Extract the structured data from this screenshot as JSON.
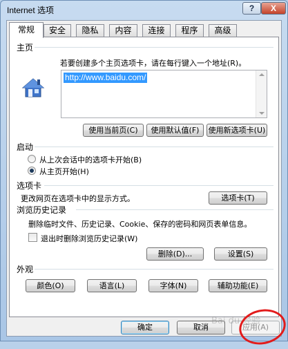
{
  "window": {
    "title": "Internet 选项",
    "help_label": "?",
    "close_label": "X"
  },
  "tabs": [
    {
      "label": "常规",
      "active": true
    },
    {
      "label": "安全"
    },
    {
      "label": "隐私"
    },
    {
      "label": "内容"
    },
    {
      "label": "连接"
    },
    {
      "label": "程序"
    },
    {
      "label": "高级"
    }
  ],
  "home": {
    "group_label": "主页",
    "instruction": "若要创建多个主页选项卡，请在每行键入一个地址(R)。",
    "url_value": "http://www.baidu.com/",
    "buttons": [
      "使用当前页(C)",
      "使用默认值(F)",
      "使用新选项卡(U)"
    ],
    "icon": "home-icon"
  },
  "startup": {
    "group_label": "启动",
    "options": [
      {
        "label": "从上次会话中的选项卡开始(B)",
        "checked": false
      },
      {
        "label": "从主页开始(H)",
        "checked": true
      }
    ]
  },
  "tabs_section": {
    "group_label": "选项卡",
    "description": "更改网页在选项卡中的显示方式。",
    "button": "选项卡(T)"
  },
  "history": {
    "group_label": "浏览历史记录",
    "description": "删除临时文件、历史记录、Cookie、保存的密码和网页表单信息。",
    "checkbox_label": "退出时删除浏览历史记录(W)",
    "checkbox_checked": false,
    "delete_button": "删除(D)...",
    "settings_button": "设置(S)"
  },
  "appearance": {
    "group_label": "外观",
    "buttons": [
      "颜色(O)",
      "语言(L)",
      "字体(N)",
      "辅助功能(E)"
    ]
  },
  "footer": {
    "ok": "确定",
    "cancel": "取消",
    "apply": "应用(A)",
    "watermark": "Bai du 经验"
  },
  "colors": {
    "selection": "#3399ff",
    "annotation": "#e21b1b"
  }
}
